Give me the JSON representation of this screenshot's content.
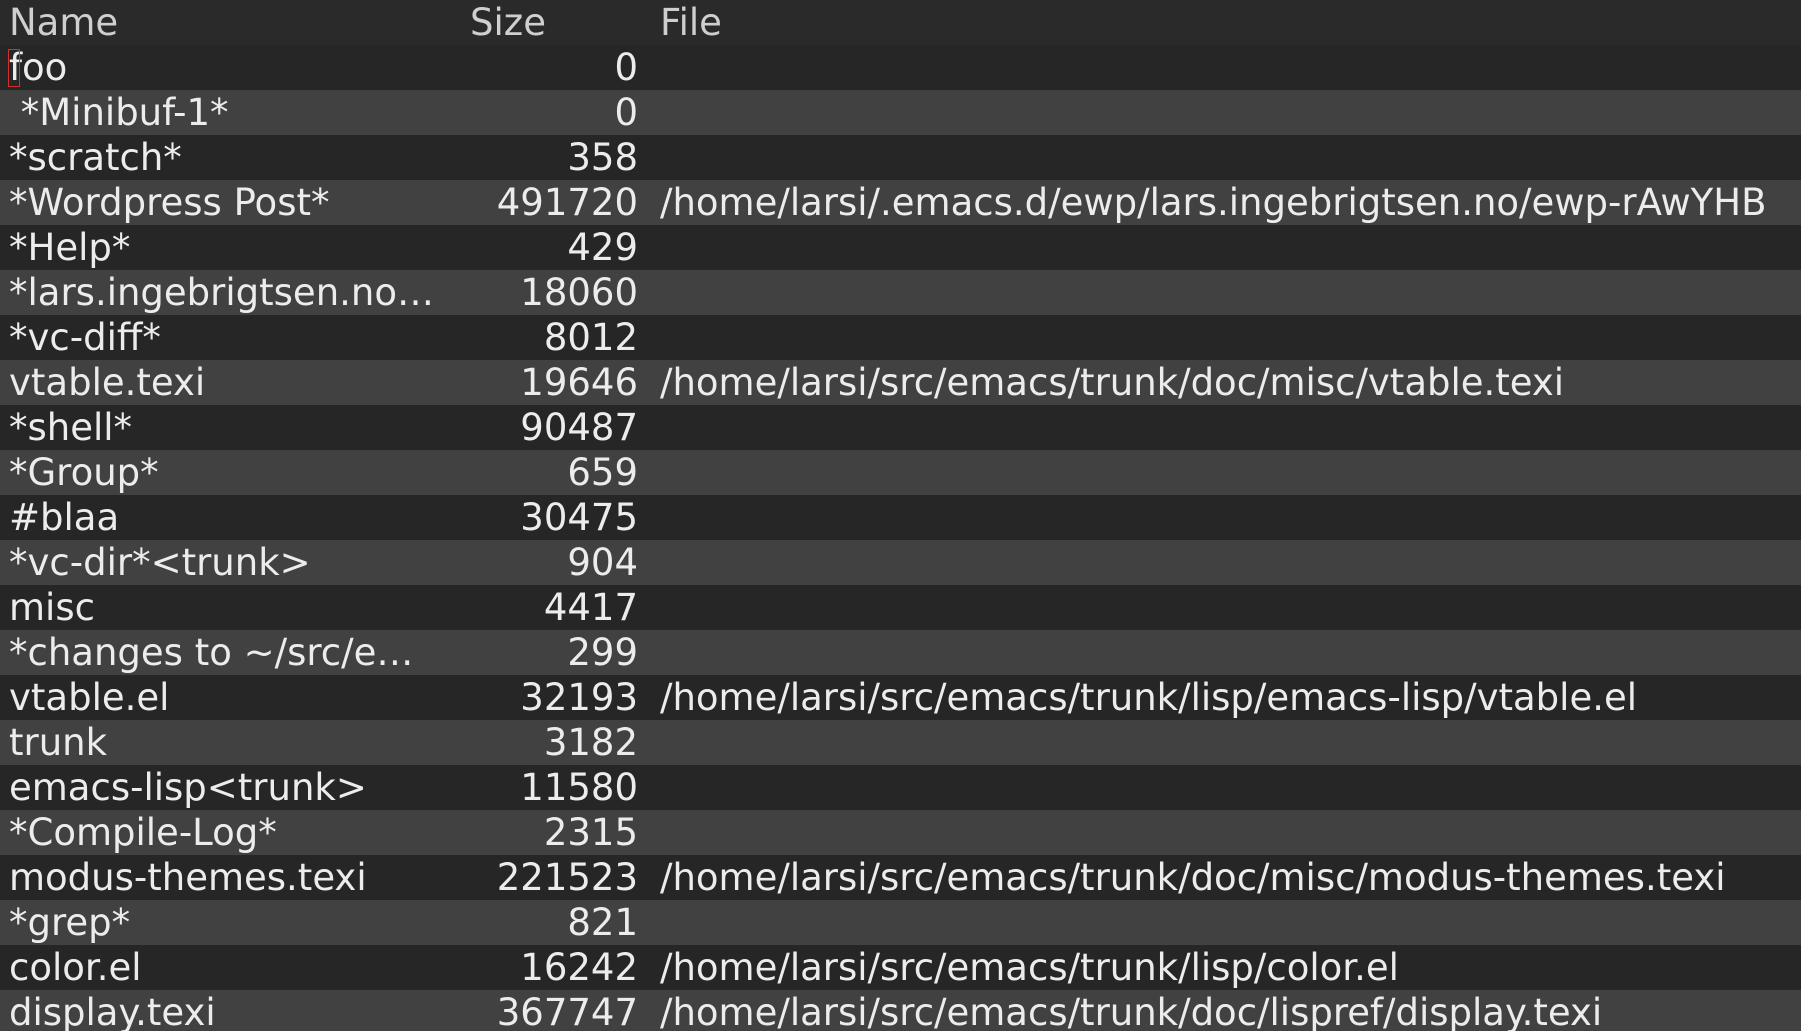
{
  "header": {
    "name": "Name",
    "size": "Size",
    "file": "File"
  },
  "rows": [
    {
      "name": "foo",
      "size": "0",
      "file": ""
    },
    {
      "name": " *Minibuf-1*",
      "size": "0",
      "file": ""
    },
    {
      "name": "*scratch*",
      "size": "358",
      "file": ""
    },
    {
      "name": "*Wordpress Post*",
      "size": "491720",
      "file": "/home/larsi/.emacs.d/ewp/lars.ingebrigtsen.no/ewp-rAwYHB"
    },
    {
      "name": "*Help*",
      "size": "429",
      "file": ""
    },
    {
      "name": "*lars.ingebrigtsen.no…",
      "size": "18060",
      "file": ""
    },
    {
      "name": "*vc-diff*",
      "size": "8012",
      "file": ""
    },
    {
      "name": "vtable.texi",
      "size": "19646",
      "file": "/home/larsi/src/emacs/trunk/doc/misc/vtable.texi"
    },
    {
      "name": "*shell*",
      "size": "90487",
      "file": ""
    },
    {
      "name": "*Group*",
      "size": "659",
      "file": ""
    },
    {
      "name": "#blaa",
      "size": "30475",
      "file": ""
    },
    {
      "name": "*vc-dir*<trunk>",
      "size": "904",
      "file": ""
    },
    {
      "name": "misc",
      "size": "4417",
      "file": ""
    },
    {
      "name": "*changes to ~/src/e…",
      "size": "299",
      "file": ""
    },
    {
      "name": "vtable.el",
      "size": "32193",
      "file": "/home/larsi/src/emacs/trunk/lisp/emacs-lisp/vtable.el"
    },
    {
      "name": "trunk",
      "size": "3182",
      "file": ""
    },
    {
      "name": "emacs-lisp<trunk>",
      "size": "11580",
      "file": ""
    },
    {
      "name": "*Compile-Log*",
      "size": "2315",
      "file": ""
    },
    {
      "name": "modus-themes.texi",
      "size": "221523",
      "file": "/home/larsi/src/emacs/trunk/doc/misc/modus-themes.texi"
    },
    {
      "name": "*grep*",
      "size": "821",
      "file": ""
    },
    {
      "name": "color.el",
      "size": "16242",
      "file": "/home/larsi/src/emacs/trunk/lisp/color.el"
    },
    {
      "name": "display.texi",
      "size": "367747",
      "file": "/home/larsi/src/emacs/trunk/doc/lispref/display.texi"
    }
  ],
  "colors": {
    "background": "#2a2a2a",
    "row_dark": "#262626",
    "row_light": "#414141",
    "text": "#ececec",
    "cursor": "#d03030"
  }
}
